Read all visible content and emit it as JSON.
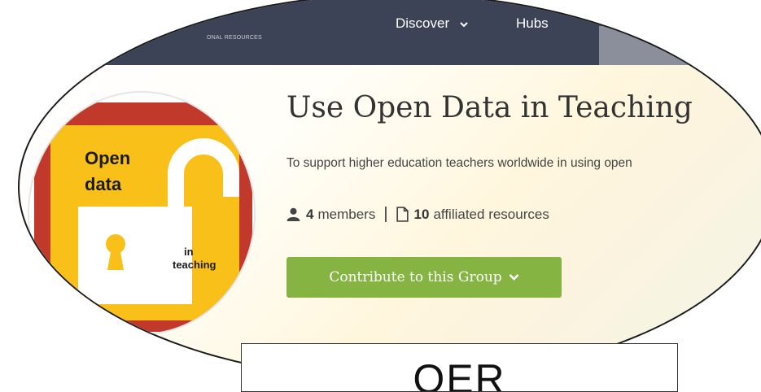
{
  "brand": {
    "subtitle": "ONAL RESOURCES"
  },
  "nav": {
    "discover": "Discover",
    "hubs": "Hubs"
  },
  "group": {
    "title": "Use Open Data in Teaching",
    "description": "To support higher education teachers worldwide in using open",
    "members_count": "4",
    "members_label": "members",
    "resources_count": "10",
    "resources_label": "affiliated resources",
    "separator": "|",
    "contribute_label": "Contribute to this Group"
  },
  "logo": {
    "line1": "Open",
    "line2": "data",
    "line3": "in",
    "line4": "teaching"
  },
  "oer": {
    "label": "OER"
  },
  "colors": {
    "nav_bg": "#3d4356",
    "button": "#86b443",
    "logo_yellow": "#f9c01a",
    "logo_red": "#c0392b"
  }
}
